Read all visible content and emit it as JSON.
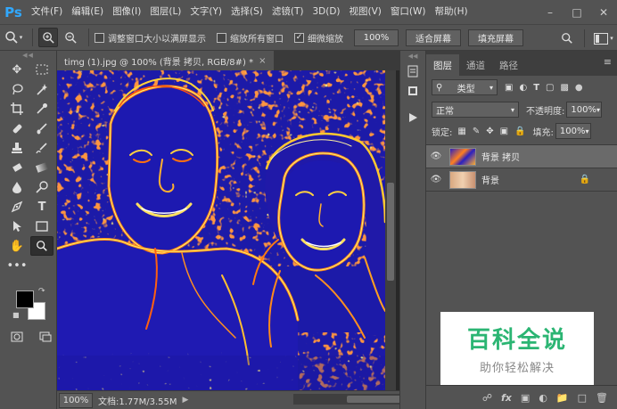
{
  "app": {
    "logo": "Ps"
  },
  "menu": [
    "文件(F)",
    "编辑(E)",
    "图像(I)",
    "图层(L)",
    "文字(Y)",
    "选择(S)",
    "滤镜(T)",
    "3D(D)",
    "视图(V)",
    "窗口(W)",
    "帮助(H)"
  ],
  "options": {
    "resize_windows": "调整窗口大小以满屏显示",
    "zoom_all_windows": "缩放所有窗口",
    "scrubby_zoom": "细微缩放",
    "zoom_value": "100%",
    "fit_screen": "适合屏幕",
    "fill_screen": "填充屏幕"
  },
  "document": {
    "tab_title": "timg (1).jpg @ 100% (背景 拷贝, RGB/8#) *",
    "close": "×",
    "status_zoom": "100%",
    "status_doc": "文档:1.77M/3.55M"
  },
  "layers_panel": {
    "tabs": [
      "图层",
      "通道",
      "路径"
    ],
    "filter_label": "类型",
    "blend_mode": "正常",
    "opacity_label": "不透明度:",
    "opacity_value": "100%",
    "lock_label": "锁定:",
    "fill_label": "填充:",
    "fill_value": "100%",
    "layers": [
      {
        "name": "背景 拷贝",
        "selected": true
      },
      {
        "name": "背景",
        "selected": false
      }
    ]
  },
  "watermark": {
    "title": "百科全说",
    "subtitle": "助你轻松解决"
  }
}
